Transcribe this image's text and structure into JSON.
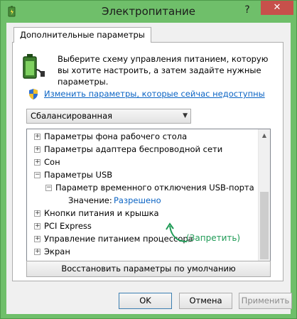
{
  "window": {
    "title": "Электропитание",
    "help": "?",
    "close": "✕"
  },
  "tab": {
    "label": "Дополнительные параметры"
  },
  "description": "Выберите схему управления питанием, которую вы хотите настроить, а затем задайте нужные параметры.",
  "change_link": "Изменить параметры, которые сейчас недоступны",
  "scheme": {
    "selected": "Сбалансированная"
  },
  "tree": [
    {
      "toggle": "+",
      "label": "Параметры фона рабочего стола"
    },
    {
      "toggle": "+",
      "label": "Параметры адаптера беспроводной сети"
    },
    {
      "toggle": "+",
      "label": "Сон"
    },
    {
      "toggle": "−",
      "label": "Параметры USB"
    },
    {
      "toggle": "−",
      "label": "Параметр временного отключения USB-порта"
    },
    {
      "label": "Значение:",
      "value": "Разрешено"
    },
    {
      "toggle": "+",
      "label": "Кнопки питания и крышка"
    },
    {
      "toggle": "+",
      "label": "PCI Express"
    },
    {
      "toggle": "+",
      "label": "Управление питанием процессора"
    },
    {
      "toggle": "+",
      "label": "Экран"
    }
  ],
  "annotation": "(Запретить)",
  "buttons": {
    "restore": "Восстановить параметры по умолчанию",
    "ok": "OK",
    "cancel": "Отмена",
    "apply": "Применить"
  },
  "colors": {
    "frame": "#6fbf6a",
    "link": "#0b64c4",
    "annotation": "#1e9a55",
    "close": "#c7504b"
  }
}
